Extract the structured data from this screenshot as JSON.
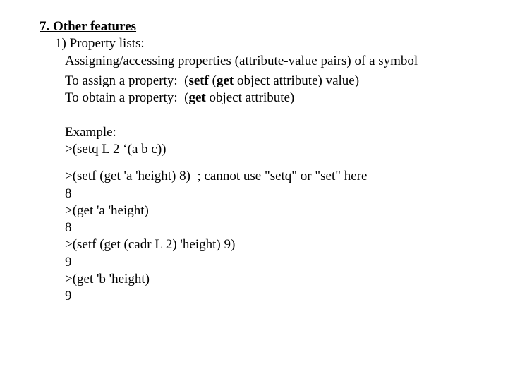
{
  "heading": "7. Other features",
  "item1": {
    "title": "1) Property lists:",
    "desc": "Assigning/accessing properties (attribute-value pairs) of a symbol",
    "assign_prefix": "To assign a property:  (",
    "assign_setf": "setf",
    "assign_mid": " (",
    "assign_get": "get",
    "assign_suffix": " object attribute) value)",
    "obtain_prefix": "To obtain a property:  (",
    "obtain_get": "get",
    "obtain_suffix": " object attribute)"
  },
  "example": {
    "label": "Example:",
    "l1": ">(setq L 2 ‘(a b c))",
    "l2": ">(setf (get 'a 'height) 8)  ; cannot use \"setq\" or \"set\" here",
    "l3": "8",
    "l4": ">(get 'a 'height)",
    "l5": "8",
    "l6": ">(setf (get (cadr L 2) 'height) 9)",
    "l7": "9",
    "l8": ">(get 'b 'height)",
    "l9": "9"
  }
}
